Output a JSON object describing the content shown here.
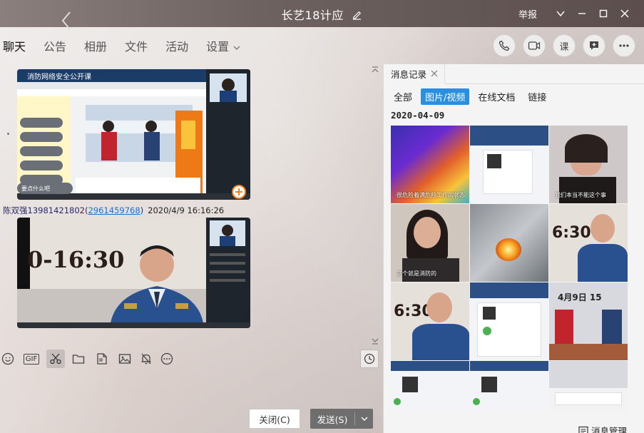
{
  "window": {
    "title": "长艺18计应",
    "report_label": "举报"
  },
  "tabs": [
    {
      "label": "聊天"
    },
    {
      "label": "公告"
    },
    {
      "label": "相册"
    },
    {
      "label": "文件"
    },
    {
      "label": "活动"
    },
    {
      "label": "设置"
    }
  ],
  "header_tools": {
    "class_label": "课"
  },
  "chat": {
    "image1_title": "消防网络安全公开课",
    "image1_tooltip": "要点什么吧",
    "sender_name": "陈双强13981421802",
    "sender_qq": "2961459768",
    "sender_time": "2020/4/9 16:16:26",
    "image2_overlay_text": "0-16:30"
  },
  "toolbar": {
    "gif_label": "GIF"
  },
  "buttons": {
    "close_label": "关闭(C)",
    "send_label": "发送(S)"
  },
  "panel": {
    "tab_label": "消息记录",
    "filters": [
      {
        "label": "全部"
      },
      {
        "label": "图片/视频"
      },
      {
        "label": "在线文档"
      },
      {
        "label": "链接"
      }
    ],
    "date": "2020-04-09",
    "thumbs": [
      {
        "caption": "很危险着满危险工作的状态下"
      },
      {
        "caption": ""
      },
      {
        "caption": "我们本当不能这个事"
      },
      {
        "caption": "这个就是消防的"
      },
      {
        "caption": ""
      },
      {
        "caption": "6:30"
      },
      {
        "caption": "6:30"
      },
      {
        "caption": ""
      },
      {
        "caption": "4月9日 15"
      },
      {
        "caption": ""
      },
      {
        "caption": ""
      },
      {
        "caption": ""
      }
    ],
    "manage_label": "消息管理"
  },
  "colors": {
    "titlebar": "#6d6260",
    "accent": "#2b8fe0",
    "send_button": "#6e6e6e"
  }
}
